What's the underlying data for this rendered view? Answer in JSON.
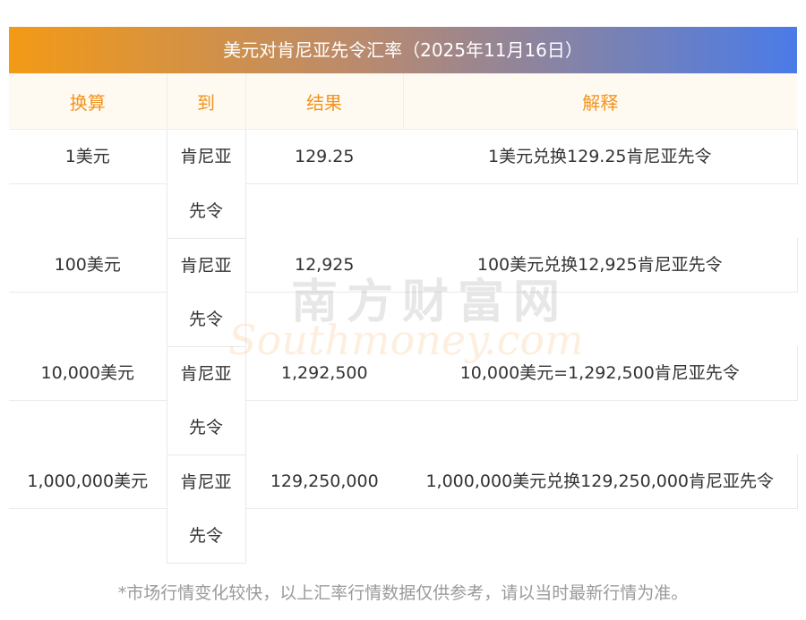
{
  "title": "美元对肯尼亚先令汇率（2025年11月16日）",
  "headers": [
    "换算",
    "到",
    "结果",
    "解释"
  ],
  "to_line1": "肯尼亚",
  "to_line2": "先令",
  "rows": [
    {
      "from": "1美元",
      "result": "129.25",
      "explain": "1美元兑换129.25肯尼亚先令"
    },
    {
      "from": "100美元",
      "result": "12,925",
      "explain": "100美元兑换12,925肯尼亚先令"
    },
    {
      "from": "10,000美元",
      "result": "1,292,500",
      "explain": "10,000美元=1,292,500肯尼亚先令"
    },
    {
      "from": "1,000,000美元",
      "result": "129,250,000",
      "explain": "1,000,000美元兑换129,250,000肯尼亚先令"
    }
  ],
  "watermark": {
    "cn": "南方财富网",
    "en": "Southmoney.com"
  },
  "footer": "*市场行情变化较快，以上汇率行情数据仅供参考，请以当时最新行情为准。",
  "colors": {
    "header_text": "#f2941e",
    "gradient_start": "#f39a16",
    "gradient_end": "#4a7be8"
  }
}
